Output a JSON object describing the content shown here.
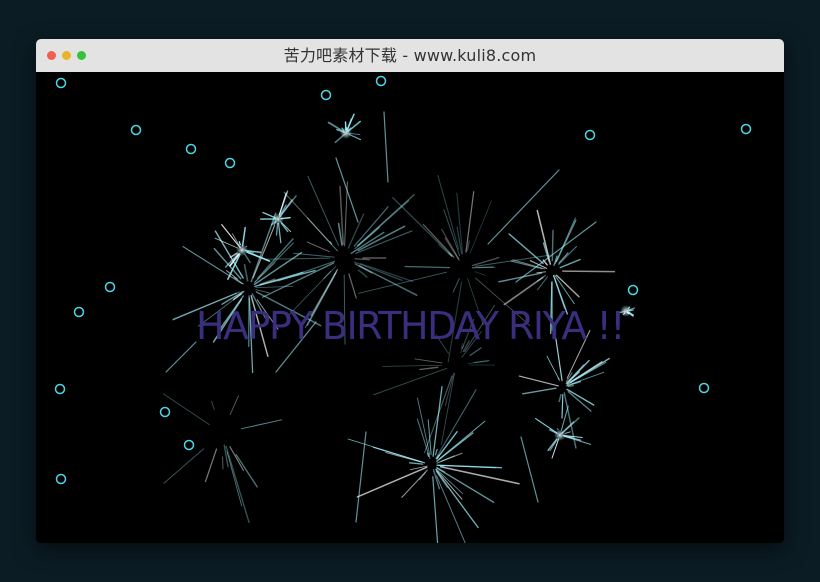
{
  "window": {
    "title": "苦力吧素材下载 - www.kuli8.com",
    "traffic_lights": {
      "close": "#f25f4c",
      "minimize": "#e8b42a",
      "zoom": "#37c23b"
    }
  },
  "canvas": {
    "message": "HAPPY BIRTHDAY RIYA !!",
    "message_color": "#3a2e7e",
    "background": "#000000",
    "spark_color": "#9ff3ff",
    "spark_core_color": "#ffffff",
    "ring_color": "#4ed6e6"
  }
}
